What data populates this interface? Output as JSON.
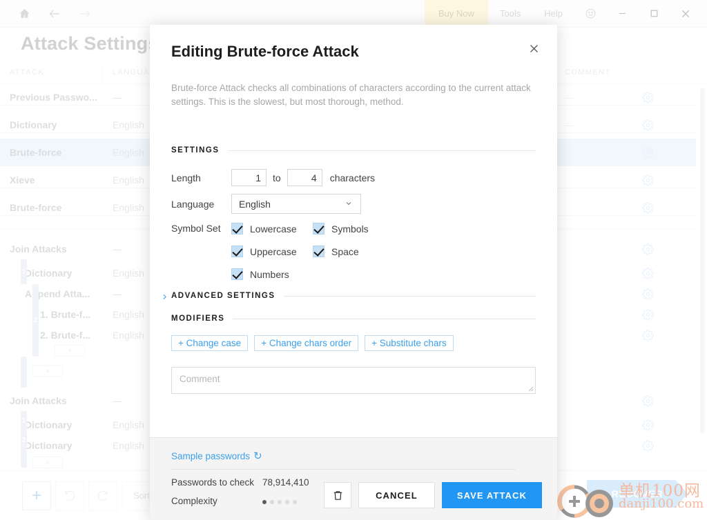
{
  "titlebar": {
    "nav": [
      {
        "name": "home-icon",
        "label": "Home"
      },
      {
        "name": "back-icon",
        "label": "Back"
      },
      {
        "name": "forward-icon",
        "label": "Forward"
      }
    ],
    "buy_now": "Buy Now",
    "tools": "Tools",
    "help": "Help",
    "smiley": "☺",
    "minimize": "─",
    "maximize": "□",
    "close": "✕"
  },
  "page": {
    "title": "Attack Settings"
  },
  "table": {
    "columns": [
      "ATTACK",
      "LANGUAGE",
      "COMMENT"
    ],
    "rows": [
      {
        "attack": "Previous Passwo...",
        "language": "—",
        "comment": "—",
        "indent": 0,
        "selected": false,
        "group": null
      },
      {
        "attack": "Dictionary",
        "language": "English",
        "comment": "—",
        "indent": 0,
        "selected": false,
        "group": null
      },
      {
        "attack": "Brute-force",
        "language": "English",
        "comment": "",
        "indent": 0,
        "selected": true,
        "group": null
      },
      {
        "attack": "Xieve",
        "language": "English",
        "comment": "",
        "indent": 0,
        "selected": false,
        "group": null
      },
      {
        "attack": "Brute-force",
        "language": "English",
        "comment": "",
        "indent": 0,
        "selected": false,
        "group": null
      },
      {
        "attack": "Join Attacks",
        "language": "—",
        "comment": "",
        "indent": 0,
        "selected": false,
        "group": null
      },
      {
        "attack": "Dictionary",
        "language": "English",
        "comment": "",
        "indent": 1,
        "selected": false,
        "group": "1"
      },
      {
        "attack": "Append Atta...",
        "language": "—",
        "comment": "",
        "indent": 1,
        "selected": false,
        "group": null
      },
      {
        "attack": "1. Brute-f...",
        "language": "English",
        "comment": "",
        "indent": 2,
        "selected": false,
        "group": "2"
      },
      {
        "attack": "2. Brute-f...",
        "language": "English",
        "comment": "",
        "indent": 2,
        "selected": false,
        "group": null
      },
      {
        "attack": "Join Attacks",
        "language": "—",
        "comment": "",
        "indent": 0,
        "selected": false,
        "group": null
      },
      {
        "attack": "Dictionary",
        "language": "English",
        "comment": "",
        "indent": 1,
        "selected": false,
        "group": "1"
      },
      {
        "attack": "Dictionary",
        "language": "English",
        "comment": "",
        "indent": 1,
        "selected": false,
        "group": "2"
      }
    ],
    "add_row_label": "+"
  },
  "bottombar": {
    "add": "+",
    "undo": "undo-icon",
    "redo": "redo-icon",
    "sort": "Sort",
    "recover": "RECOVER"
  },
  "watermark": {
    "line1": "单机100网",
    "line2": "danji100.com"
  },
  "dialog": {
    "title": "Editing Brute-force Attack",
    "close": "✕",
    "description": "Brute-force Attack checks all combinations of characters according to the current attack settings. This is the slowest, but most thorough, method.",
    "sections": {
      "settings": "SETTINGS",
      "advanced": "ADVANCED SETTINGS",
      "modifiers": "MODIFIERS"
    },
    "length": {
      "label": "Length",
      "min": "1",
      "to": "to",
      "max": "4",
      "suffix": "characters"
    },
    "language": {
      "label": "Language",
      "value": "English",
      "options": [
        "English"
      ]
    },
    "symbol_set": {
      "label": "Symbol Set",
      "items": [
        {
          "label": "Lowercase",
          "checked": true
        },
        {
          "label": "Symbols",
          "checked": true
        },
        {
          "label": "Uppercase",
          "checked": true
        },
        {
          "label": "Space",
          "checked": true
        },
        {
          "label": "Numbers",
          "checked": true
        }
      ]
    },
    "modifiers": [
      {
        "label": "+ Change case"
      },
      {
        "label": "+ Change chars order"
      },
      {
        "label": "+ Substitute chars"
      }
    ],
    "comment": {
      "placeholder": "Comment",
      "value": ""
    },
    "footer": {
      "sample_link": "Sample passwords",
      "refresh_icon": "↻",
      "passwords_label": "Passwords to check",
      "passwords_value": "78,914,410",
      "complexity_label": "Complexity",
      "complexity_filled": 1,
      "complexity_total": 5,
      "delete_label": "delete-icon",
      "cancel_label": "CANCEL",
      "save_label": "SAVE ATTACK"
    }
  },
  "colors": {
    "accent": "#2196f3",
    "link": "#3ba0e8",
    "selected_row": "#ddeefb",
    "buy_now_bg": "#faeebe",
    "checkbox": "#c6e0f5"
  }
}
